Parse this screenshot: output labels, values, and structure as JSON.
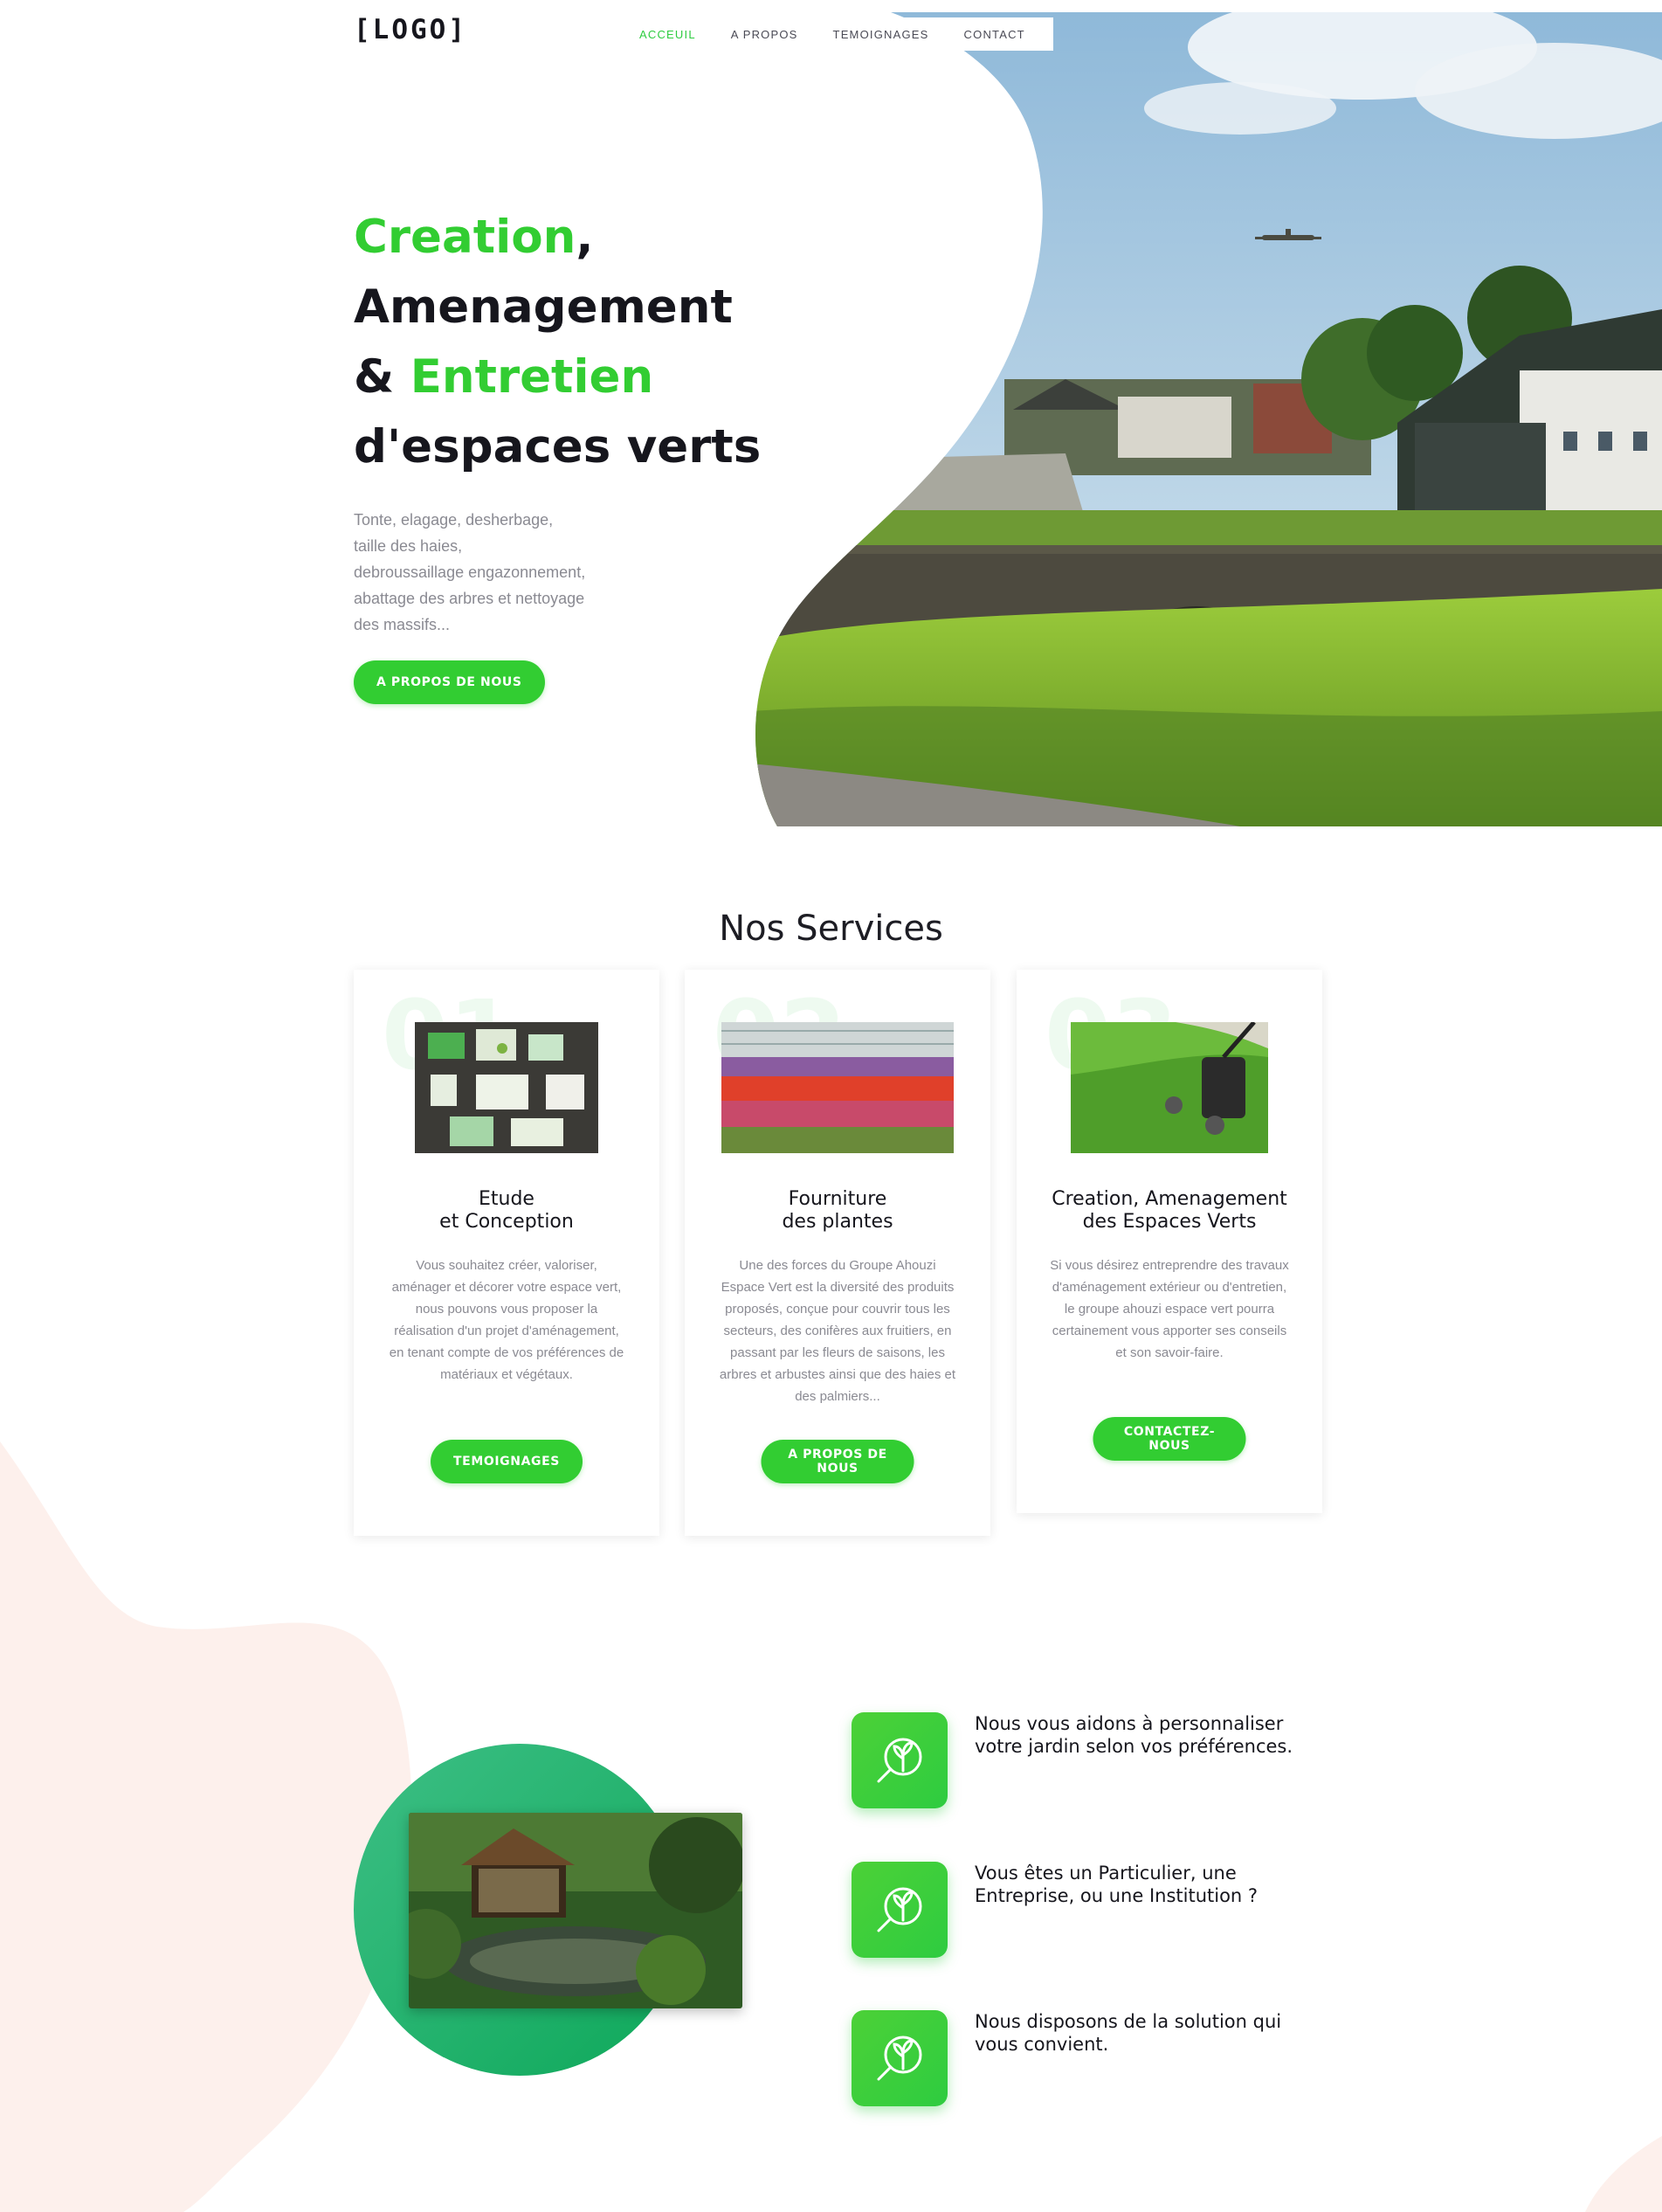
{
  "header": {
    "logo": "[LOGO]",
    "nav": [
      "ACCEUIL",
      "A PROPOS",
      "TEMOIGNAGES",
      "CONTACT"
    ],
    "active_index": 0
  },
  "hero": {
    "title": {
      "w1": "Creation",
      "comma": ",",
      "w2": "Amenagement",
      "amp": "&",
      "w3": "Entretien",
      "w4": "d'espaces verts"
    },
    "description_lines": [
      "Tonte, elagage, desherbage,",
      "taille des haies,",
      "debroussaillage engazonnement,",
      "abattage des arbres et nettoyage",
      "des massifs..."
    ],
    "button": "A PROPOS DE NOUS"
  },
  "services": {
    "title": "Nos Services",
    "cards": [
      {
        "number": "01",
        "title_line1": "Etude",
        "title_line2": "et Conception",
        "text": "Vous souhaitez créer, valoriser, aménager et décorer votre espace vert, nous pouvons vous proposer la réalisation d'un projet d'aménagement, en tenant compte de vos préférences de matériaux et végétaux.",
        "button": "TEMOIGNAGES"
      },
      {
        "number": "02",
        "title_line1": "Fourniture",
        "title_line2": "des plantes",
        "text": "Une des forces du Groupe Ahouzi Espace Vert est la diversité des produits proposés, conçue pour couvrir tous les secteurs, des conifères aux fruitiers, en passant par les fleurs de saisons, les arbres et arbustes ainsi que des haies et des palmiers...",
        "button": "A PROPOS DE NOUS"
      },
      {
        "number": "03",
        "title_line1": "Creation, Amenagement",
        "title_line2": "des Espaces Verts",
        "text": "Si vous désirez entreprendre des travaux d'aménagement extérieur ou d'entretien, le groupe ahouzi espace vert pourra certainement vous apporter ses conseils et son savoir-faire.",
        "button": "CONTACTEZ-NOUS"
      }
    ]
  },
  "features": [
    {
      "icon": "tree-search-icon",
      "line1": "Nous vous aidons à personnaliser",
      "line2": "votre jardin selon vos préférences."
    },
    {
      "icon": "tree-search-icon",
      "line1": "Vous êtes un Particulier, une",
      "line2": "Entreprise, ou une Institution ?"
    },
    {
      "icon": "tree-search-icon",
      "line1": "Nous disposons de la solution qui",
      "line2": "vous convient."
    }
  ],
  "colors": {
    "accent": "#32cd32",
    "dark": "#16161d",
    "muted": "#8a8a92",
    "blob": "#fdf0ec"
  }
}
